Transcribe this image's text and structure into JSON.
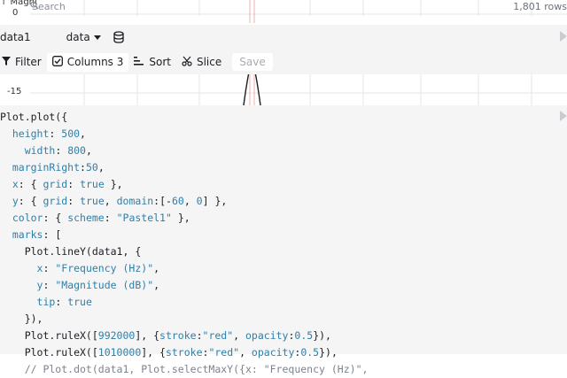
{
  "chart_top": {
    "axis_title": "↑ Magni",
    "tick_zero": "0",
    "search_placeholder": "Search",
    "rows_count": "1,801 rows"
  },
  "data_header": {
    "variable_name": "data1",
    "source_label": "data"
  },
  "toolbar": {
    "filter_label": "Filter",
    "columns_label": "Columns 3",
    "sort_label": "Sort",
    "slice_label": "Slice",
    "save_label": "Save"
  },
  "chart_bottom": {
    "tick_label": "-15"
  },
  "code_lines": [
    "Plot.plot({",
    "  height: 500,",
    "    width: 800,",
    "  marginRight:50,",
    "  x: { grid: true },",
    "  y: { grid: true, domain:[-60, 0] },",
    "  color: { scheme: \"Pastel1\" },",
    "  marks: [",
    "    Plot.lineY(data1, {",
    "      x: \"Frequency (Hz)\",",
    "      y: \"Magnitude (dB)\",",
    "      tip: true",
    "    }),",
    "    Plot.ruleX([992000], {stroke:\"red\", opacity:0.5}),",
    "    Plot.ruleX([1010000], {stroke:\"red\", opacity:0.5}),",
    "    // Plot.dot(data1, Plot.selectMaxY({x: \"Frequency (Hz)\","
  ],
  "colors": {
    "accent_code": "#2f7fa8",
    "comment": "#7d838c",
    "rule_red": "#e06666",
    "toolbar_bg": "#f4f4f5"
  }
}
